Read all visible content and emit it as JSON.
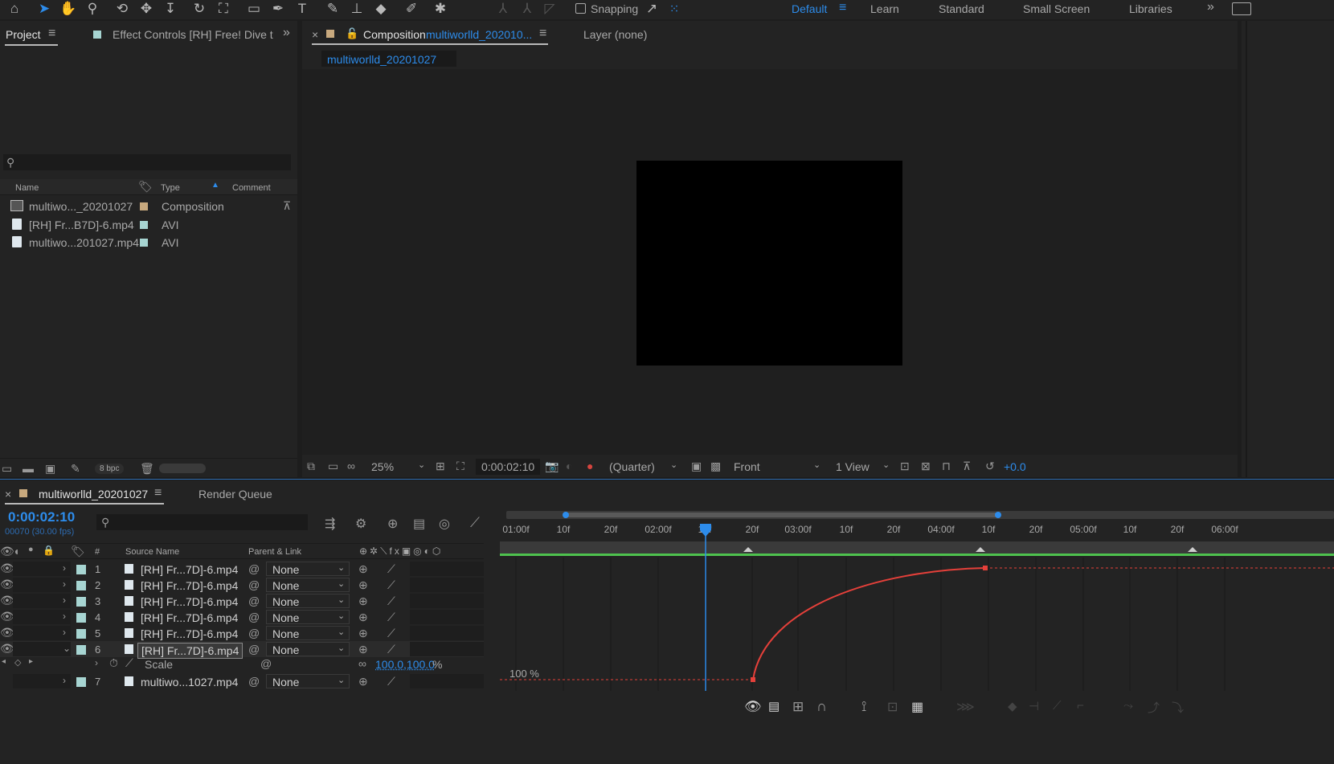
{
  "toolbar": {
    "snapping_label": "Snapping",
    "workspaces": [
      "Default",
      "Learn",
      "Standard",
      "Small Screen",
      "Libraries"
    ]
  },
  "project_panel": {
    "tab_project": "Project",
    "tab_effect_controls": "Effect Controls [RH] Free! Dive t",
    "columns": {
      "name": "Name",
      "type": "Type",
      "comment": "Comment"
    },
    "items": [
      {
        "name": "multiwo..._20201027",
        "type": "Composition",
        "swatch": "#c8a97e"
      },
      {
        "name": "[RH] Fr...B7D]-6.mp4",
        "type": "AVI",
        "swatch": "#a7d5d2"
      },
      {
        "name": "multiwo...201027.mp4",
        "type": "AVI",
        "swatch": "#a7d5d2"
      }
    ],
    "bpc": "8 bpc"
  },
  "composition_panel": {
    "tab_prefix": "Composition",
    "tab_name": "multiworlld_202010...",
    "layer_tab": "Layer  (none)",
    "breadcrumb": "multiworlld_20201027",
    "zoom": "25%",
    "timecode": "0:00:02:10",
    "resolution": "(Quarter)",
    "view": "Front",
    "views": "1 View",
    "exposure": "+0.0"
  },
  "timeline": {
    "tab_name": "multiworlld_20201027",
    "render_queue": "Render Queue",
    "timecode": "0:00:02:10",
    "frames": "00070 (30.00 fps)",
    "columns": {
      "num": "#",
      "source": "Source Name",
      "parent": "Parent & Link"
    },
    "ruler": [
      "01:00f",
      "10f",
      "20f",
      "02:00f",
      "10f",
      "20f",
      "03:00f",
      "10f",
      "20f",
      "04:00f",
      "10f",
      "20f",
      "05:00f",
      "10f",
      "20f",
      "06:00f"
    ],
    "layers": [
      {
        "num": "1",
        "name": "[RH] Fr...7D]-6.mp4",
        "parent": "None"
      },
      {
        "num": "2",
        "name": "[RH] Fr...7D]-6.mp4",
        "parent": "None"
      },
      {
        "num": "3",
        "name": "[RH] Fr...7D]-6.mp4",
        "parent": "None"
      },
      {
        "num": "4",
        "name": "[RH] Fr...7D]-6.mp4",
        "parent": "None"
      },
      {
        "num": "5",
        "name": "[RH] Fr...7D]-6.mp4",
        "parent": "None"
      },
      {
        "num": "6",
        "name": "[RH] Fr...7D]-6.mp4",
        "parent": "None"
      },
      {
        "num": "7",
        "name": "multiwo...1027.mp4",
        "parent": "None"
      }
    ],
    "property": {
      "name": "Scale",
      "value": "100.0,100.0",
      "unit": "%"
    },
    "graph_label": "100 %"
  },
  "colors": {
    "accent": "#2d8ceb",
    "curve": "#e5403a",
    "work_area": "#4ec24e",
    "layer_swatch": "#a7d5d2"
  }
}
